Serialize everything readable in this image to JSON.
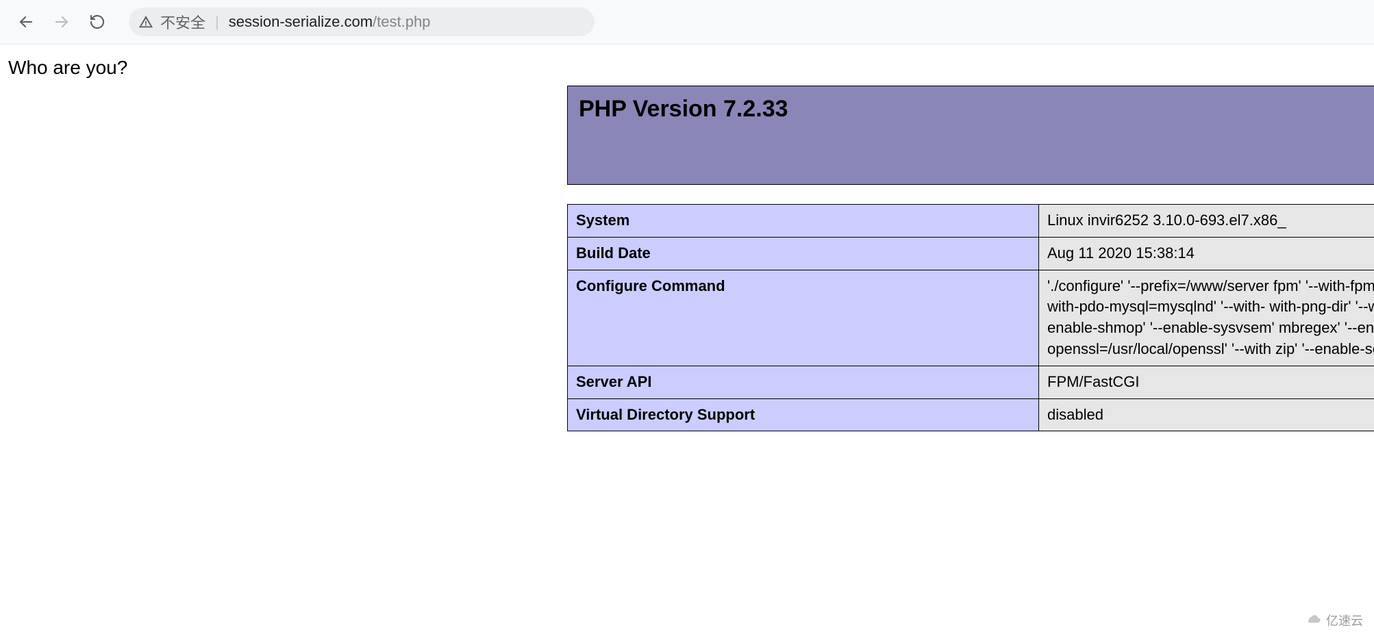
{
  "browser": {
    "insecure_label": "不安全",
    "url_host": "session-serialize.com",
    "url_path": "/test.php"
  },
  "page": {
    "heading": "Who are you?"
  },
  "phpinfo": {
    "title": "PHP Version 7.2.33",
    "rows": [
      {
        "key": "System",
        "value": "Linux invir6252 3.10.0-693.el7.x86_"
      },
      {
        "key": "Build Date",
        "value": "Aug 11 2020 15:38:14"
      },
      {
        "key": "Configure Command",
        "value": "'./configure' '--prefix=/www/server fpm' '--with-fpm-user=www' '--wit with-pdo-mysql=mysqlnd' '--with- with-png-dir' '--with-zlib' '--with-li enable-shmop' '--enable-sysvsem' mbregex' '--enable-mbstring' '--en openssl=/usr/local/openssl' '--with zip' '--enable-soap' '--with-gettext'"
      },
      {
        "key": "Server API",
        "value": "FPM/FastCGI"
      },
      {
        "key": "Virtual Directory Support",
        "value": "disabled"
      }
    ]
  },
  "watermark": {
    "label": "亿速云"
  }
}
